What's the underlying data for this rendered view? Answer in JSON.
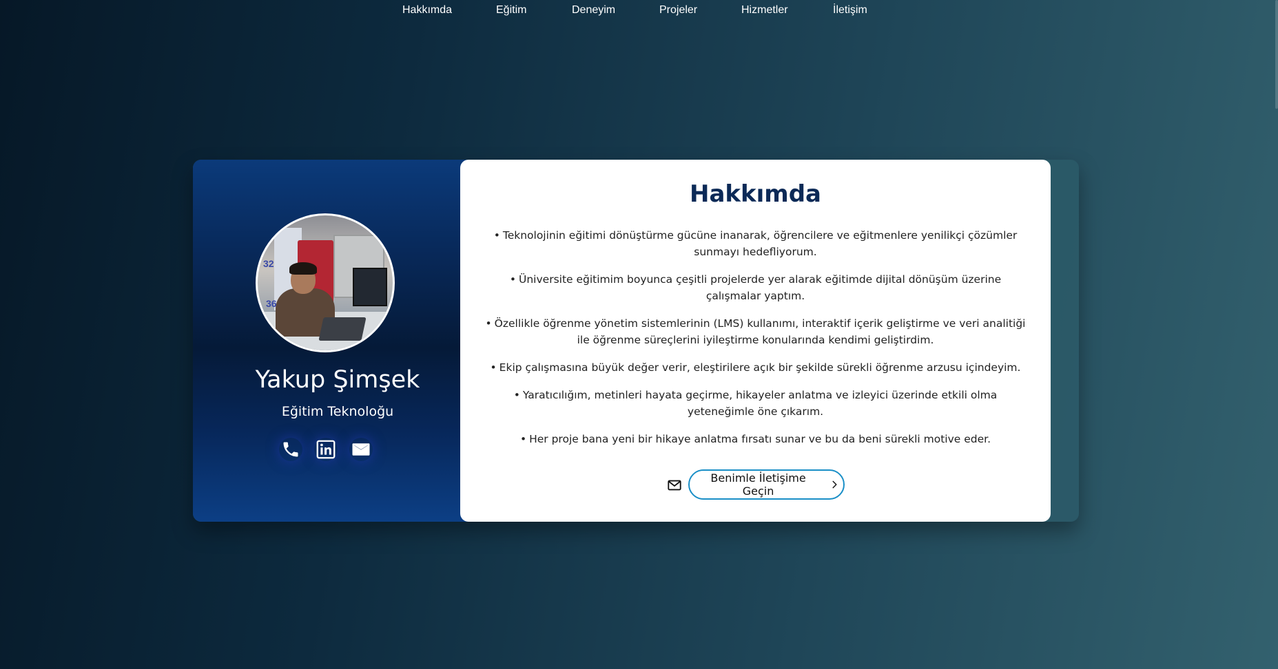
{
  "nav": {
    "items": [
      {
        "label": "Hakkımda"
      },
      {
        "label": "Eğitim"
      },
      {
        "label": "Deneyim"
      },
      {
        "label": "Projeler"
      },
      {
        "label": "Hizmetler"
      },
      {
        "label": "İletişim"
      }
    ]
  },
  "profile": {
    "name": "Yakup Şimşek",
    "title": "Eğitim Teknoloğu",
    "avatar_numbers": [
      "32",
      "36"
    ],
    "social": [
      {
        "icon": "phone-icon"
      },
      {
        "icon": "linkedin-icon"
      },
      {
        "icon": "mail-icon"
      }
    ]
  },
  "about": {
    "heading": "Hakkımda",
    "bullet_char": "•",
    "bullets": [
      "Teknolojinin eğitimi dönüştürme gücüne inanarak, öğrencilere ve eğitmenlere yenilikçi çözümler sunmayı hedefliyorum.",
      "Üniversite eğitimim boyunca çeşitli projelerde yer alarak eğitimde dijital dönüşüm üzerine çalışmalar yaptım.",
      "Özellikle öğrenme yönetim sistemlerinin (LMS) kullanımı, interaktif içerik geliştirme ve veri analitiği ile öğrenme süreçlerini iyileştirme konularında kendimi geliştirdim.",
      "Ekip çalışmasına büyük değer verir, eleştirilere açık bir şekilde sürekli öğrenme arzusu içindeyim.",
      "Yaratıcılığım, metinleri hayata geçirme, hikayeler anlatma ve izleyici üzerinde etkili olma yeteneğimle öne çıkarım.",
      "Her proje bana yeni bir hikaye anlatma fırsatı sunar ve bu da beni sürekli motive eder."
    ],
    "cta_label": "Benimle İletişime Geçin"
  },
  "colors": {
    "heading": "#0c2a57",
    "cta_border": "#1a8fc7",
    "profile_panel": "#08295a"
  }
}
